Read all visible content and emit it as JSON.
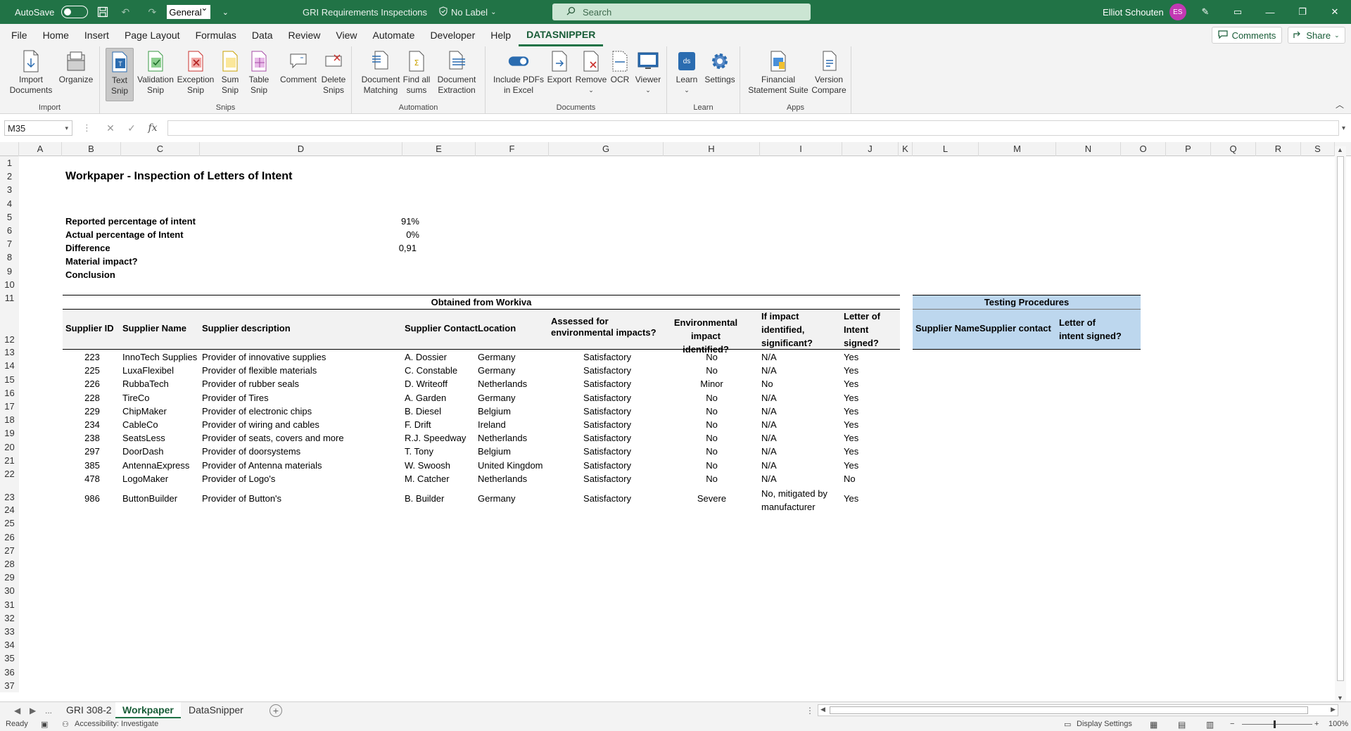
{
  "titlebar": {
    "autosave_label": "AutoSave",
    "number_format": "General",
    "document_title": "GRI Requirements Inspections",
    "sensitivity_label": "No Label",
    "search_placeholder": "Search",
    "user_name": "Elliot Schouten",
    "user_initials": "ES"
  },
  "menu": {
    "items": [
      "File",
      "Home",
      "Insert",
      "Page Layout",
      "Formulas",
      "Data",
      "Review",
      "View",
      "Automate",
      "Developer",
      "Help",
      "DATASNIPPER"
    ],
    "active": "DATASNIPPER",
    "comments_label": "Comments",
    "share_label": "Share"
  },
  "ribbon": {
    "import": {
      "label": "Import",
      "import_documents": "Import\nDocuments",
      "organize": "Organize"
    },
    "snips": {
      "label": "Snips",
      "text_snip": "Text\nSnip",
      "validation_snip": "Validation\nSnip",
      "exception_snip": "Exception\nSnip",
      "sum_snip": "Sum\nSnip",
      "table_snip": "Table\nSnip",
      "comment": "Comment",
      "delete_snips": "Delete\nSnips"
    },
    "automation": {
      "label": "Automation",
      "document_matching": "Document\nMatching",
      "find_all_sums": "Find all\nsums",
      "document_extraction": "Document\nExtraction"
    },
    "documents": {
      "label": "Documents",
      "include_pdfs": "Include PDFs\nin Excel",
      "export": "Export",
      "remove": "Remove",
      "ocr": "OCR",
      "viewer": "Viewer"
    },
    "learn": {
      "label": "Learn",
      "learn": "Learn",
      "settings": "Settings"
    },
    "apps": {
      "label": "Apps",
      "financial_statement_suite": "Financial\nStatement Suite",
      "version_compare": "Version\nCompare"
    }
  },
  "formula_bar": {
    "name_box": "M35",
    "formula": ""
  },
  "columns": [
    "A",
    "B",
    "C",
    "D",
    "E",
    "F",
    "G",
    "H",
    "I",
    "J",
    "K",
    "L",
    "M",
    "N",
    "O",
    "P",
    "Q",
    "R",
    "S"
  ],
  "rows": [
    "1",
    "2",
    "3",
    "4",
    "5",
    "6",
    "7",
    "8",
    "9",
    "10",
    "11",
    "12",
    "13",
    "14",
    "15",
    "16",
    "17",
    "18",
    "19",
    "20",
    "21",
    "22",
    "23",
    "24",
    "25",
    "26",
    "27",
    "28",
    "29",
    "30",
    "31",
    "32",
    "33",
    "34",
    "35",
    "36",
    "37"
  ],
  "sheet": {
    "title": "Workpaper - Inspection of Letters of Intent",
    "summary": [
      {
        "label": "Reported percentage of intent",
        "value": "91%"
      },
      {
        "label": "Actual percentage of Intent",
        "value": "0%"
      },
      {
        "label": "Difference",
        "value": "0,91"
      },
      {
        "label": "Material impact?",
        "value": ""
      },
      {
        "label": "Conclusion",
        "value": ""
      }
    ],
    "workiva_header": "Obtained from Workiva",
    "testing_header": "Testing Procedures",
    "headers": {
      "supplier_id": "Supplier ID",
      "supplier_name": "Supplier Name",
      "supplier_description": "Supplier description",
      "supplier_contact": "Supplier Contact",
      "location": "Location",
      "assessed": "Assessed for environmental impacts?",
      "env_impact": "Environmental impact identified?",
      "significant": "If impact identified, significant?",
      "letter_signed": "Letter of Intent signed?",
      "tp_supplier_name": "Supplier Name",
      "tp_supplier_contact": "Supplier contact",
      "tp_letter_signed": "Letter of intent signed?"
    },
    "suppliers": [
      {
        "id": "223",
        "name": "InnoTech Supplies",
        "description": "Provider of innovative supplies",
        "contact": "A. Dossier",
        "location": "Germany",
        "assessed": "Satisfactory",
        "impact": "No",
        "significant": "N/A",
        "signed": "Yes"
      },
      {
        "id": "225",
        "name": "LuxaFlexibel",
        "description": "Provider of flexible materials",
        "contact": "C. Constable",
        "location": "Germany",
        "assessed": "Satisfactory",
        "impact": "No",
        "significant": "N/A",
        "signed": "Yes"
      },
      {
        "id": "226",
        "name": "RubbaTech",
        "description": "Provider of rubber seals",
        "contact": "D. Writeoff",
        "location": "Netherlands",
        "assessed": "Satisfactory",
        "impact": "Minor",
        "significant": "No",
        "signed": "Yes"
      },
      {
        "id": "228",
        "name": "TireCo",
        "description": "Provider of Tires",
        "contact": "A. Garden",
        "location": "Germany",
        "assessed": "Satisfactory",
        "impact": "No",
        "significant": "N/A",
        "signed": "Yes"
      },
      {
        "id": "229",
        "name": "ChipMaker",
        "description": "Provider of electronic chips",
        "contact": "B. Diesel",
        "location": "Belgium",
        "assessed": "Satisfactory",
        "impact": "No",
        "significant": "N/A",
        "signed": "Yes"
      },
      {
        "id": "234",
        "name": "CableCo",
        "description": "Provider of wiring and cables",
        "contact": "F. Drift",
        "location": "Ireland",
        "assessed": "Satisfactory",
        "impact": "No",
        "significant": "N/A",
        "signed": "Yes"
      },
      {
        "id": "238",
        "name": "SeatsLess",
        "description": "Provider of seats, covers and more",
        "contact": "R.J. Speedway",
        "location": "Netherlands",
        "assessed": "Satisfactory",
        "impact": "No",
        "significant": "N/A",
        "signed": "Yes"
      },
      {
        "id": "297",
        "name": "DoorDash",
        "description": "Provider of doorsystems",
        "contact": "T. Tony",
        "location": "Belgium",
        "assessed": "Satisfactory",
        "impact": "No",
        "significant": "N/A",
        "signed": "Yes"
      },
      {
        "id": "385",
        "name": "AntennaExpress",
        "description": "Provider of Antenna materials",
        "contact": "W. Swoosh",
        "location": "United Kingdom",
        "assessed": "Satisfactory",
        "impact": "No",
        "significant": "N/A",
        "signed": "Yes"
      },
      {
        "id": "478",
        "name": "LogoMaker",
        "description": "Provider of Logo's",
        "contact": "M. Catcher",
        "location": "Netherlands",
        "assessed": "Satisfactory",
        "impact": "No",
        "significant": "N/A",
        "signed": "No"
      },
      {
        "id": "986",
        "name": "ButtonBuilder",
        "description": "Provider of Button's",
        "contact": "B. Builder",
        "location": "Germany",
        "assessed": "Satisfactory",
        "impact": "Severe",
        "significant": "No, mitigated by manufacturer",
        "signed": "Yes"
      }
    ]
  },
  "sheet_tabs": {
    "ellipsis": "...",
    "tabs": [
      "GRI 308-2",
      "Workpaper",
      "DataSnipper"
    ],
    "active": "Workpaper"
  },
  "statusbar": {
    "ready": "Ready",
    "accessibility": "Accessibility: Investigate",
    "display_settings": "Display Settings",
    "zoom": "100%"
  },
  "colors": {
    "excel_green": "#217346",
    "testing_blue": "#bdd7ee",
    "avatar": "#c239b3"
  },
  "icons": [
    "save-icon",
    "undo-icon",
    "redo-icon",
    "search-icon",
    "sensitivity-icon",
    "pen-icon",
    "ribbon-display-icon",
    "minimize-icon",
    "restore-icon",
    "close-icon"
  ]
}
